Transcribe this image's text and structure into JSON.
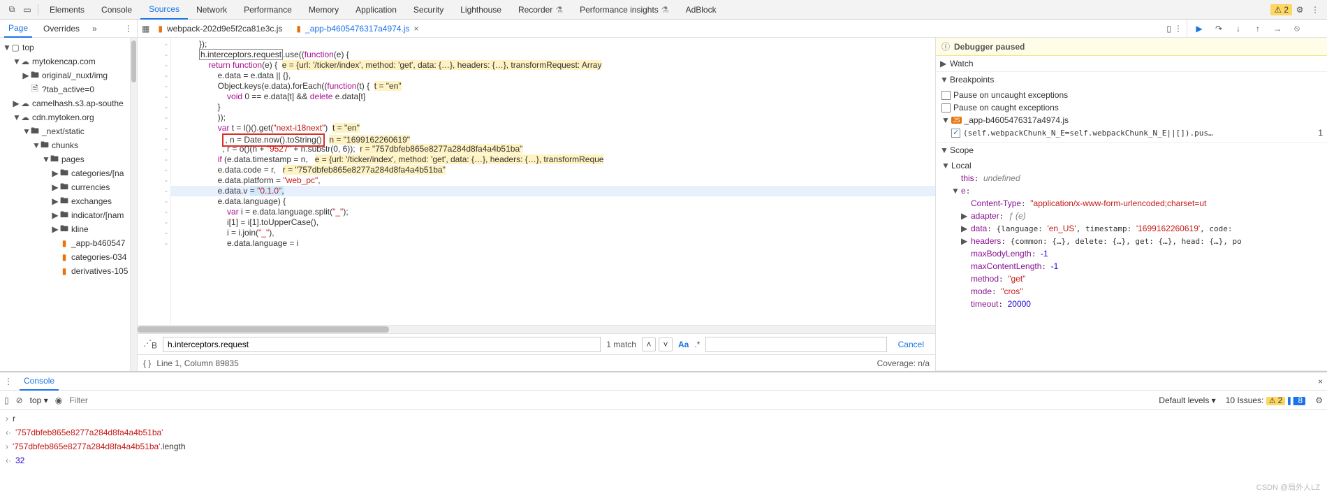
{
  "topTabs": {
    "items": [
      "Elements",
      "Console",
      "Sources",
      "Network",
      "Performance",
      "Memory",
      "Application",
      "Security",
      "Lighthouse",
      "Recorder",
      "Performance insights",
      "AdBlock"
    ],
    "active": "Sources",
    "warnCount": "2"
  },
  "subbar": {
    "leftTabs": [
      "Page",
      "Overrides"
    ],
    "leftActive": "Page",
    "files": [
      {
        "name": "webpack-202d9e5f2ca81e3c.js",
        "active": false
      },
      {
        "name": "_app-b4605476317a4974.js",
        "active": true
      }
    ]
  },
  "navigator": {
    "tree": [
      {
        "indent": 0,
        "tw": "▼",
        "icon": "window",
        "label": "top"
      },
      {
        "indent": 1,
        "tw": "▼",
        "icon": "cloud",
        "label": "mytokencap.com"
      },
      {
        "indent": 2,
        "tw": "▶",
        "icon": "folder",
        "label": "original/_nuxt/img"
      },
      {
        "indent": 2,
        "tw": "",
        "icon": "file",
        "label": "?tab_active=0"
      },
      {
        "indent": 1,
        "tw": "▶",
        "icon": "cloud",
        "label": "camelhash.s3.ap-southe"
      },
      {
        "indent": 1,
        "tw": "▼",
        "icon": "cloud",
        "label": "cdn.mytoken.org"
      },
      {
        "indent": 2,
        "tw": "▼",
        "icon": "folder",
        "label": "_next/static"
      },
      {
        "indent": 3,
        "tw": "▼",
        "icon": "folder",
        "label": "chunks"
      },
      {
        "indent": 4,
        "tw": "▼",
        "icon": "folder",
        "label": "pages"
      },
      {
        "indent": 5,
        "tw": "▶",
        "icon": "folder",
        "label": "categories/[na"
      },
      {
        "indent": 5,
        "tw": "▶",
        "icon": "folder",
        "label": "currencies"
      },
      {
        "indent": 5,
        "tw": "▶",
        "icon": "folder",
        "label": "exchanges"
      },
      {
        "indent": 5,
        "tw": "▶",
        "icon": "folder",
        "label": "indicator/[nam"
      },
      {
        "indent": 5,
        "tw": "▶",
        "icon": "folder",
        "label": "kline"
      },
      {
        "indent": 5,
        "tw": "",
        "icon": "js",
        "label": "_app-b460547"
      },
      {
        "indent": 5,
        "tw": "",
        "icon": "js",
        "label": "categories-034"
      },
      {
        "indent": 5,
        "tw": "",
        "icon": "js",
        "label": "derivatives-105"
      }
    ]
  },
  "code": {
    "lines": [
      {
        "html": "            });"
      },
      {
        "html": "            <span class='boxed'>h.interceptors.request</span>.use((<span class='kw'>function</span>(e) {"
      },
      {
        "html": "                <span class='kw'>return function</span>(e) {  <span class='hl-y'>e = {url: '/ticker/index', method: 'get', data: {…}, headers: {…}, transformRequest: Array</span>"
      },
      {
        "html": "                    e.data = e.data || {},"
      },
      {
        "html": "                    Object.keys(e.data).forEach((<span class='kw'>function</span>(t) {  <span class='hl-y'>t = \"en\"</span>"
      },
      {
        "html": "                        <span class='kw'>void</span> 0 == e.data[t] && <span class='kw'>delete</span> e.data[t]"
      },
      {
        "html": "                    }"
      },
      {
        "html": "                    ));"
      },
      {
        "html": "                    <span class='kw'>var</span> t = l()().get(<span class='str'>\"next-i18next\"</span>)  <span class='hl-y'>t = \"en\"</span>"
      },
      {
        "html": "                      <span class='redbox'>, n = Date.now().toString()</span>  <span class='hl-y'>n = \"1699162260619\"</span>"
      },
      {
        "html": "                      , r = o()(n + <span class='str'>\"9527\"</span> + n.substr(0, 6));  <span class='hl-y'>r = \"757dbfeb865e8277a284d8fa4a4b51ba\"</span>"
      },
      {
        "html": "                    <span class='kw'>if</span> (e.data.timestamp = n,   <span class='hl-y'>e = {url: '/ticker/index', method: 'get', data: {…}, headers: {…}, transformReque</span>"
      },
      {
        "html": "                    e.data.code = r,   <span class='hl-y'>r = \"757dbfeb865e8277a284d8fa4a4b51ba\"</span>"
      },
      {
        "html": "                    e.data.platform = <span class='str'>\"web_pc\"</span>,"
      },
      {
        "sel": true,
        "html": "                    e.data.v <span class='hl-b'>= <span class='str'>\"0.1.0\"</span>,</span>"
      },
      {
        "html": "                    e.data.language) {"
      },
      {
        "html": "                        <span class='kw'>var</span> i = e.data.language.split(<span class='str'>\"_\"</span>);"
      },
      {
        "html": "                        i[1] = i[1].toUpperCase(),"
      },
      {
        "html": "                        i = i.join(<span class='str'>\"_\"</span>),"
      },
      {
        "html": "                        e.data.language = i"
      }
    ]
  },
  "find": {
    "value": "h.interceptors.request",
    "matches": "1 match",
    "cancel": "Cancel"
  },
  "status": {
    "pos": "Line 1, Column 89835",
    "coverage": "Coverage: n/a"
  },
  "debugger": {
    "banner": "Debugger paused",
    "sections": {
      "watch": "Watch",
      "breakpoints": {
        "title": "Breakpoints",
        "rows": [
          {
            "checked": false,
            "label": "Pause on uncaught exceptions"
          },
          {
            "checked": false,
            "label": "Pause on caught exceptions"
          }
        ],
        "file": "_app-b4605476317a4974.js",
        "codeRow": {
          "checked": true,
          "text": "(self.webpackChunk_N_E=self.webpackChunk_N_E||[]).pus…",
          "num": "1"
        }
      },
      "scope": {
        "title": "Scope",
        "local": "Local",
        "rows": [
          {
            "indent": 1,
            "tw": "",
            "html": "<span class='prop'>this</span>: <span class='valkw'>undefined</span>"
          },
          {
            "indent": 1,
            "tw": "▼",
            "html": "<span class='prop'>e</span>:"
          },
          {
            "indent": 2,
            "tw": "",
            "html": "<span class='prop'>Content-Type</span>: <span class='valstr'>\"application/x-www-form-urlencoded;charset=ut</span>"
          },
          {
            "indent": 2,
            "tw": "▶",
            "html": "<span class='prop'>adapter</span>: <span class='valkw'>ƒ (e)</span>"
          },
          {
            "indent": 2,
            "tw": "▶",
            "html": "<span class='prop'>data</span>: {language: <span class='valstr'>'en_US'</span>, timestamp: <span class='valstr'>'1699162260619'</span>, code:"
          },
          {
            "indent": 2,
            "tw": "▶",
            "html": "<span class='prop'>headers</span>: {common: {…}, delete: {…}, get: {…}, head: {…}, po"
          },
          {
            "indent": 2,
            "tw": "",
            "html": "<span class='prop'>maxBodyLength</span>: <span class='valnum'>-1</span>"
          },
          {
            "indent": 2,
            "tw": "",
            "html": "<span class='prop'>maxContentLength</span>: <span class='valnum'>-1</span>"
          },
          {
            "indent": 2,
            "tw": "",
            "html": "<span class='prop'>method</span>: <span class='valstr'>\"get\"</span>"
          },
          {
            "indent": 2,
            "tw": "",
            "html": "<span class='prop'>mode</span>: <span class='valstr'>\"cros\"</span>"
          },
          {
            "indent": 2,
            "tw": "",
            "html": "<span class='prop'>timeout</span>: <span class='valnum'>20000</span>"
          }
        ]
      }
    }
  },
  "console": {
    "tab": "Console",
    "contextLabel": "top ▾",
    "filterPlaceholder": "Filter",
    "levels": "Default levels ▾",
    "issuesLabel": "10 Issues:",
    "issueWarn": "2",
    "issueInfo": "8",
    "rows": [
      {
        "type": "in",
        "text": "r"
      },
      {
        "type": "out",
        "html": "<span class='cstr'>'757dbfeb865e8277a284d8fa4a4b51ba'</span>"
      },
      {
        "type": "in",
        "html": "<span class='cstr'>'757dbfeb865e8277a284d8fa4a4b51ba'</span>.length"
      },
      {
        "type": "out",
        "html": "<span class='valnum'>32</span>"
      }
    ]
  },
  "watermark": "CSDN @局外人LZ"
}
